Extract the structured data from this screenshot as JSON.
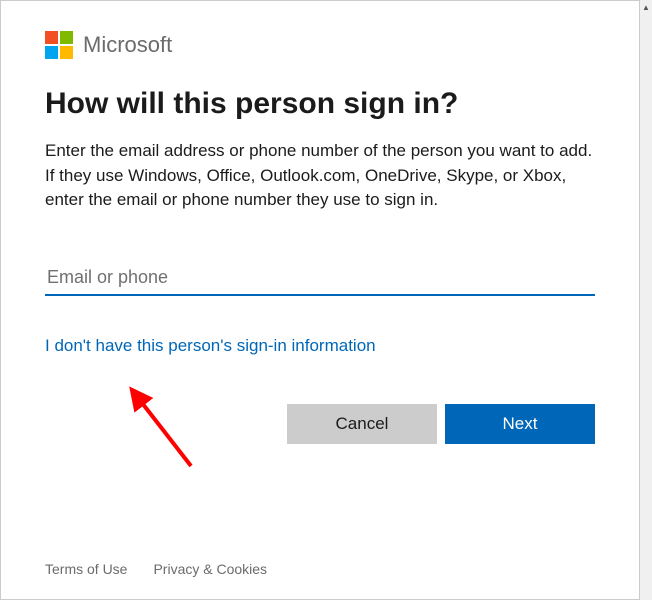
{
  "header": {
    "brand_text": "Microsoft"
  },
  "title": "How will this person sign in?",
  "description": "Enter the email address or phone number of the person you want to add. If they use Windows, Office, Outlook.com, OneDrive, Skype, or Xbox, enter the email or phone number they use to sign in.",
  "input": {
    "placeholder": "Email or phone",
    "value": ""
  },
  "link_no_info": "I don't have this person's sign-in information",
  "buttons": {
    "cancel": "Cancel",
    "next": "Next"
  },
  "footer": {
    "terms": "Terms of Use",
    "privacy": "Privacy & Cookies"
  }
}
